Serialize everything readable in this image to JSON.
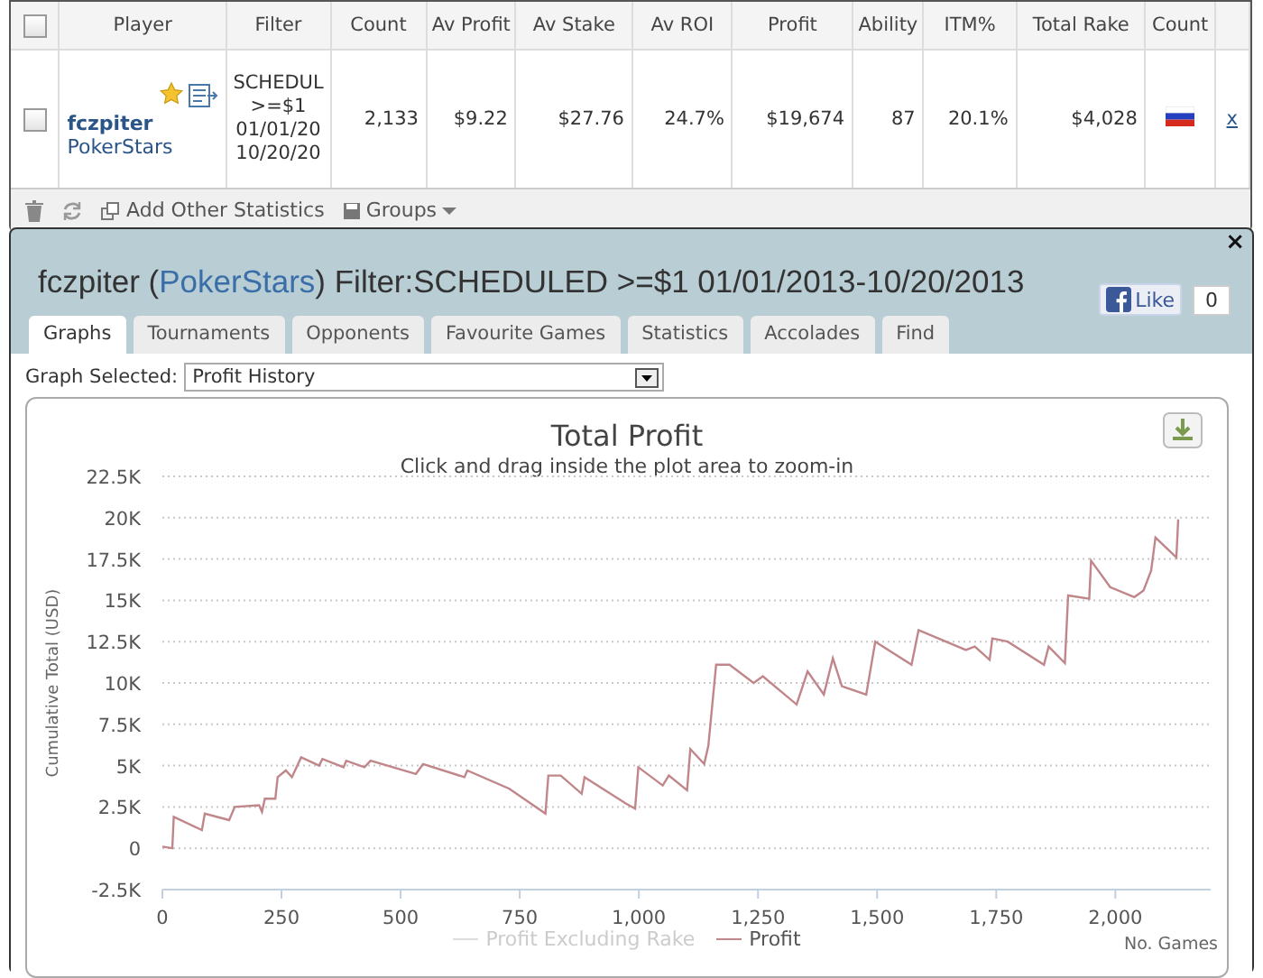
{
  "stats_table": {
    "columns": [
      {
        "label": "Player"
      },
      {
        "label": "Filter"
      },
      {
        "label": "Count"
      },
      {
        "label": "Av Profit"
      },
      {
        "label": "Av Stake"
      },
      {
        "label": "Av ROI"
      },
      {
        "label": "Profit"
      },
      {
        "label": "Ability"
      },
      {
        "label": "ITM%"
      },
      {
        "label": "Total Rake"
      },
      {
        "label": "Count"
      }
    ],
    "header_checked": false,
    "rows": [
      {
        "checked": false,
        "player": "fczpiter",
        "site": "PokerStars",
        "filter_lines": [
          "SCHEDUL",
          ">=$1",
          "01/01/20",
          "10/20/20"
        ],
        "stats": [
          "2,133",
          "$9.22",
          "$27.76",
          "24.7%",
          "$19,674",
          "87",
          "20.1%",
          "$4,028"
        ],
        "remove": "x"
      }
    ],
    "footer": {
      "add_stats": "Add Other Statistics",
      "groups": "Groups"
    }
  },
  "panel": {
    "title_player": "fczpiter (",
    "title_site": "PokerStars",
    "title_rest": ") Filter:SCHEDULED >=$1 01/01/2013-10/20/2013",
    "close": "×",
    "like_label": "Like",
    "like_count": "0",
    "tabs": [
      {
        "label": "Graphs",
        "selected": true
      },
      {
        "label": "Tournaments",
        "selected": false
      },
      {
        "label": "Opponents",
        "selected": false
      },
      {
        "label": "Favourite Games",
        "selected": false
      },
      {
        "label": "Statistics",
        "selected": false
      },
      {
        "label": "Accolades",
        "selected": false
      },
      {
        "label": "Find",
        "selected": false
      }
    ],
    "graph_label": "Graph Selected:",
    "graph_value": "Profit History",
    "subtitle": "Click and drag inside the plot area to zoom-in",
    "hidden_series": [
      {
        "label": "Profit Excluding Rake",
        "visible": false,
        "color": "#dddddd"
      }
    ],
    "chart_data": {
      "type": "line",
      "grid": true,
      "title": "Total Profit",
      "xlabel": "No. Games",
      "ylabel": "Cumulative Total (USD)",
      "xlim": [
        0,
        2200
      ],
      "ylim": [
        -2500,
        22500
      ],
      "xticks": [
        {
          "value": 0,
          "label": "0"
        },
        {
          "value": 250,
          "label": "250"
        },
        {
          "value": 500,
          "label": "500"
        },
        {
          "value": 750,
          "label": "750"
        },
        {
          "value": 1000,
          "label": "1,000"
        },
        {
          "value": 1250,
          "label": "1,250"
        },
        {
          "value": 1500,
          "label": "1,500"
        },
        {
          "value": 1750,
          "label": "1,750"
        },
        {
          "value": 2000,
          "label": "2,000"
        }
      ],
      "yticks": [
        {
          "value": -2500,
          "label": "-2.5K"
        },
        {
          "value": 0,
          "label": "0"
        },
        {
          "value": 2500,
          "label": "2.5K"
        },
        {
          "value": 5000,
          "label": "5K"
        },
        {
          "value": 7500,
          "label": "7.5K"
        },
        {
          "value": 10000,
          "label": "10K"
        },
        {
          "value": 12500,
          "label": "12.5K"
        },
        {
          "value": 15000,
          "label": "15K"
        },
        {
          "value": 17500,
          "label": "17.5K"
        },
        {
          "value": 20000,
          "label": "20K"
        },
        {
          "value": 22500,
          "label": "22.5K"
        }
      ],
      "x": [
        0,
        21,
        24,
        83,
        89,
        140,
        152,
        203,
        209,
        215,
        237,
        242,
        259,
        272,
        291,
        329,
        336,
        380,
        386,
        424,
        437,
        532,
        547,
        634,
        640,
        728,
        804,
        810,
        836,
        880,
        886,
        973,
        992,
        999,
        1050,
        1063,
        1101,
        1108,
        1137,
        1146,
        1162,
        1190,
        1241,
        1260,
        1331,
        1354,
        1388,
        1407,
        1426,
        1477,
        1496,
        1572,
        1587,
        1686,
        1705,
        1736,
        1742,
        1774,
        1850,
        1860,
        1894,
        1901,
        1945,
        1949,
        1989,
        2040,
        2059,
        2075,
        2084,
        2128,
        2132
      ],
      "series": [
        {
          "name": "Profit",
          "color": "#c0868a",
          "values": [
            100,
            0,
            1900,
            1100,
            2100,
            1700,
            2500,
            2600,
            2200,
            3000,
            3000,
            4300,
            4700,
            4300,
            5500,
            5000,
            5400,
            4900,
            5300,
            4900,
            5300,
            4500,
            5100,
            4300,
            4700,
            3600,
            2100,
            4400,
            4400,
            3300,
            4300,
            2700,
            2400,
            4900,
            3800,
            4400,
            3500,
            6000,
            5100,
            6200,
            11100,
            11100,
            10000,
            10400,
            8700,
            10700,
            9300,
            11500,
            9800,
            9300,
            12500,
            11100,
            13200,
            12000,
            12200,
            11400,
            12700,
            12500,
            11100,
            12200,
            11200,
            15300,
            15100,
            17400,
            15800,
            15200,
            15600,
            16800,
            18800,
            17600,
            19900
          ]
        }
      ]
    }
  }
}
